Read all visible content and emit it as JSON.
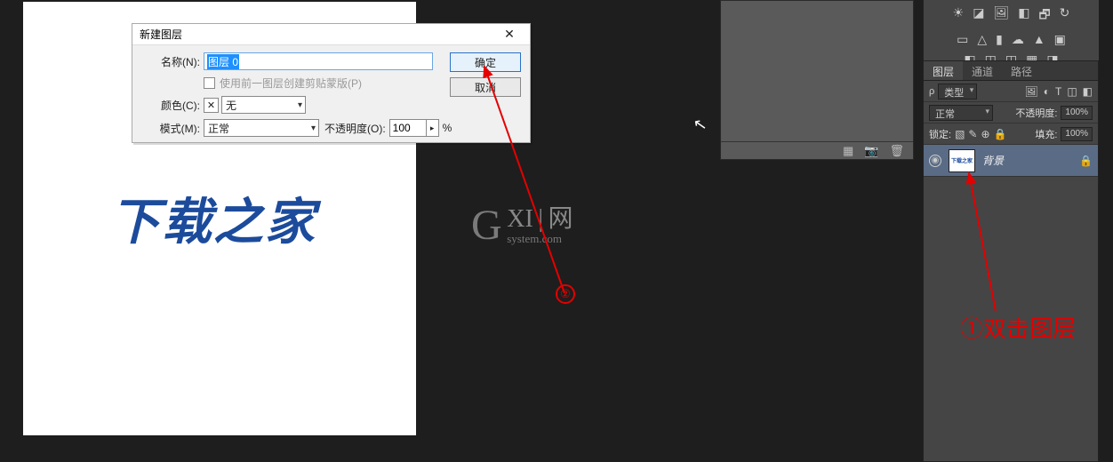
{
  "canvas": {
    "brand_text": "下载之家"
  },
  "watermark": {
    "g": "G",
    "xi": "XI",
    "bar": "|",
    "cn": "网",
    "sys": "system.com"
  },
  "dialog": {
    "title": "新建图层",
    "name_label": "名称(N):",
    "name_value": "图层 0",
    "clip_chk_label": "使用前一图层创建剪贴蒙版(P)",
    "color_label": "颜色(C):",
    "color_value": "无",
    "mode_label": "模式(M):",
    "mode_value": "正常",
    "opacity_label": "不透明度(O):",
    "opacity_value": "100",
    "opacity_unit": "%",
    "ok": "确定",
    "cancel": "取消",
    "close_glyph": "✕"
  },
  "nav": {
    "icon1": "▦",
    "icon2": "📷",
    "icon3": "🗑"
  },
  "toolopts": {
    "row1": [
      "☀",
      "◪",
      "🖼",
      "◧",
      "🗗",
      "↻"
    ],
    "row2": [
      "▭",
      "△",
      "▮",
      "☁",
      "▲",
      "▣"
    ],
    "row3": [
      "◧",
      "◫",
      "◳",
      "▦",
      "◨"
    ]
  },
  "layers": {
    "tabs": [
      "图层",
      "通道",
      "路径"
    ],
    "type_label": "类型",
    "blend_value": "正常",
    "opacity_label": "不透明度:",
    "opacity_value": "100%",
    "lock_label": "锁定:",
    "fill_label": "填充:",
    "fill_value": "100%",
    "lockicons": [
      "▧",
      "✎",
      "⊕",
      "🔒"
    ],
    "filter_icons": [
      "🖼",
      "◐",
      "T",
      "◫",
      "◧"
    ],
    "layer": {
      "name": "背景",
      "thumb_text": "下载之家"
    }
  },
  "annotations": {
    "one": "①",
    "two": "②",
    "text1": "双击图层"
  },
  "cursor_glyph": "↖"
}
